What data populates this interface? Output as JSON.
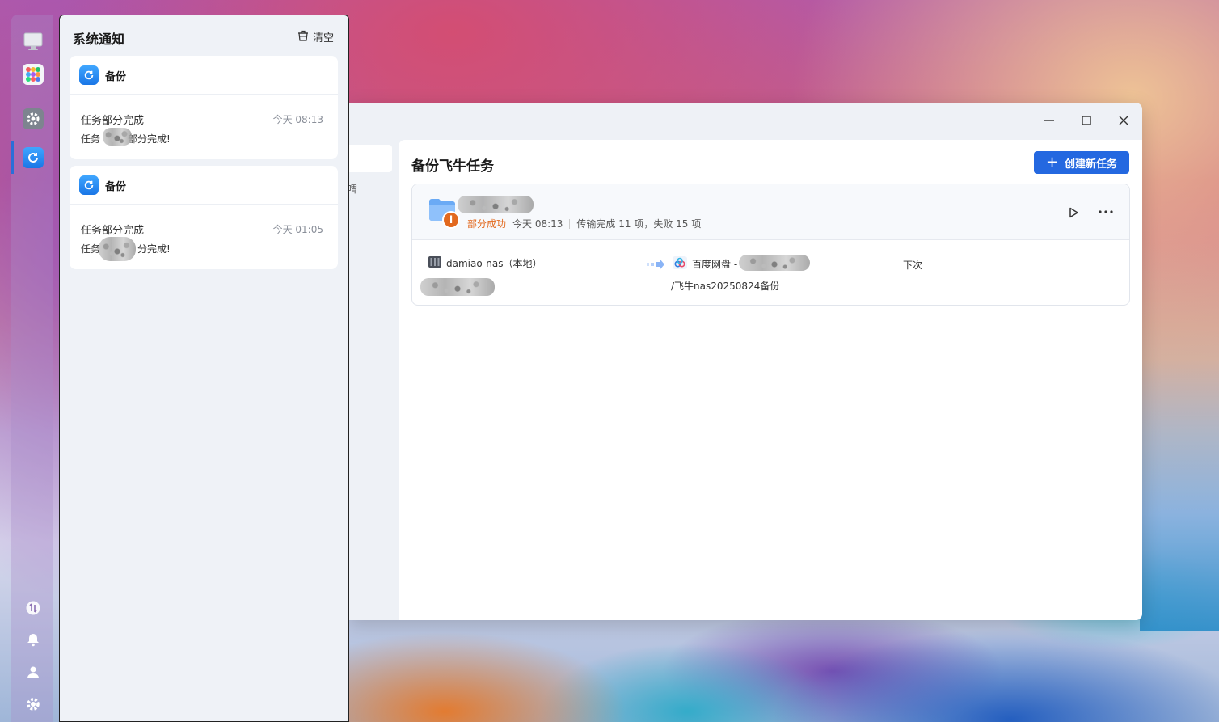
{
  "dock": {
    "icons": [
      "desktop-icon",
      "app-center-icon",
      "settings-app-icon",
      "backup-app-icon"
    ],
    "bottom_icons": [
      "transfer-icon",
      "bell-icon",
      "user-icon",
      "gear-icon"
    ]
  },
  "notifications": {
    "title": "系统通知",
    "clear_label": "清空",
    "items": [
      {
        "app_name": "备份",
        "title": "任务部分完成",
        "time": "今天 08:13",
        "body_prefix": "任务",
        "body_suffix": "部分完成!"
      },
      {
        "app_name": "备份",
        "title": "任务部分完成",
        "time": "今天 01:05",
        "body_prefix": "任务",
        "body_suffix": "分完成!"
      }
    ]
  },
  "app": {
    "side_fragment": "喟",
    "main_title": "备份飞牛任务",
    "create_button": "创建新任务",
    "task": {
      "status": "部分成功",
      "time": "今天 08:13",
      "summary": "传输完成 11 项，失败 15 项",
      "source_label": "damiao-nas（本地）",
      "dest_label": "百度网盘 -",
      "dest_path": "/飞牛nas20250824备份",
      "next_label": "下次",
      "next_value": "-"
    }
  },
  "colors": {
    "accent": "#2468e0",
    "warning": "#e2691f"
  }
}
